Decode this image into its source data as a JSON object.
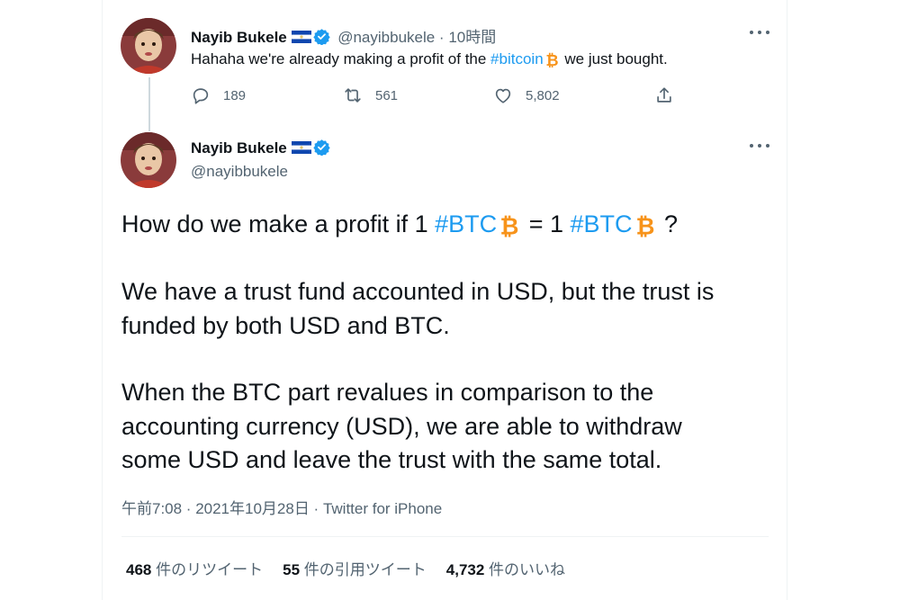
{
  "reply_tweet": {
    "author_name": "Nayib Bukele",
    "handle_time": "@nayibbukele · 10時間",
    "text_before": "Hahaha we're already making a profit of the ",
    "hashtag": "#bitcoin",
    "text_after": " we just bought.",
    "actions": {
      "replies": "189",
      "retweets": "561",
      "likes": "5,802"
    }
  },
  "main_tweet": {
    "author_name": "Nayib Bukele",
    "handle": "@nayibbukele",
    "line1": {
      "part1": "How do we make a profit if 1 ",
      "hashtag1": "#BTC",
      "part2": " = 1 ",
      "hashtag2": "#BTC",
      "part3": " ?"
    },
    "paragraph2": [
      "We have a trust fund accounted in USD, but the trust is",
      "funded by both USD and BTC."
    ],
    "paragraph3": [
      "When the BTC part revalues in comparison to the",
      "accounting currency (USD), we are able to withdraw",
      "some USD and leave the trust with the same total."
    ],
    "meta": "午前7:08 · 2021年10月28日 · Twitter for iPhone",
    "stats": {
      "retweets_count": "468",
      "retweets_label": "件のリツイート",
      "quotes_count": "55",
      "quotes_label": "件の引用ツイート",
      "likes_count": "4,732",
      "likes_label": "件のいいね"
    }
  },
  "colors": {
    "link": "#1d9bf0",
    "verified": "#1d9bf0",
    "bitcoin": "#f7931a",
    "secondary_text": "#536471"
  },
  "icons": [
    "el-salvador-flag-icon",
    "verified-badge-icon",
    "bitcoin-icon",
    "more-icon",
    "reply-icon",
    "retweet-icon",
    "like-icon",
    "share-icon"
  ]
}
